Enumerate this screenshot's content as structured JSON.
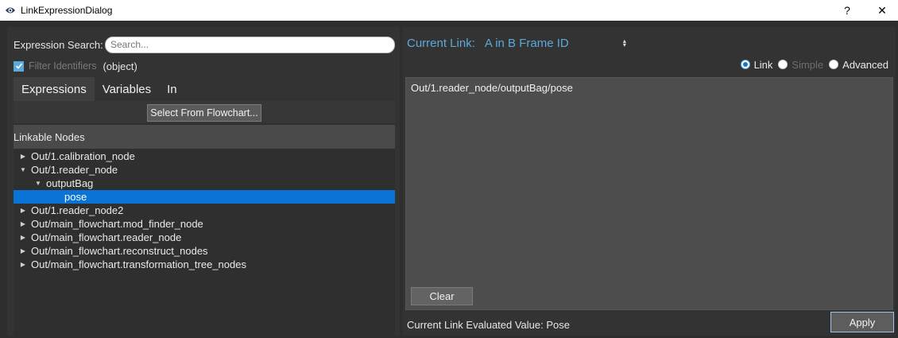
{
  "window": {
    "title": "LinkExpressionDialog",
    "help_label": "?",
    "close_label": "✕",
    "app_icon": "eye-logo-icon"
  },
  "left": {
    "search_label": "Expression Search:",
    "search_placeholder": "Search...",
    "search_value": "",
    "filter_label": "Filter Identifiers",
    "filter_checked": true,
    "filter_type": "(object)",
    "tabs": [
      {
        "label": "Expressions",
        "active": true
      },
      {
        "label": "Variables",
        "active": false
      },
      {
        "label": "In",
        "active": false
      }
    ],
    "select_button": "Select From Flowchart...",
    "tree_header": "Linkable Nodes",
    "tree": [
      {
        "label": "Out/1.calibration_node",
        "arrow": "collapsed"
      },
      {
        "label": "Out/1.reader_node",
        "arrow": "expanded"
      },
      {
        "label": "outputBag",
        "arrow": "expanded"
      },
      {
        "label": "pose",
        "arrow": "none",
        "selected": true
      },
      {
        "label": "Out/1.reader_node2",
        "arrow": "collapsed"
      },
      {
        "label": "Out/main_flowchart.mod_finder_node",
        "arrow": "collapsed"
      },
      {
        "label": "Out/main_flowchart.reader_node",
        "arrow": "collapsed"
      },
      {
        "label": "Out/main_flowchart.reconstruct_nodes",
        "arrow": "collapsed"
      },
      {
        "label": "Out/main_flowchart.transformation_tree_nodes",
        "arrow": "collapsed"
      }
    ]
  },
  "right": {
    "current_link_label": "Current Link:",
    "current_link_value": "A in B Frame ID",
    "modes": [
      {
        "label": "Link",
        "checked": true,
        "enabled": true
      },
      {
        "label": "Simple",
        "checked": false,
        "enabled": false
      },
      {
        "label": "Advanced",
        "checked": false,
        "enabled": true
      }
    ],
    "expression": "Out/1.reader_node/outputBag/pose",
    "clear_button": "Clear",
    "evaluated_label": "Current Link Evaluated Value: Pose",
    "apply_button": "Apply"
  },
  "colors": {
    "accent": "#5ba9da",
    "selection": "#0a73d6",
    "background": "#333333"
  }
}
